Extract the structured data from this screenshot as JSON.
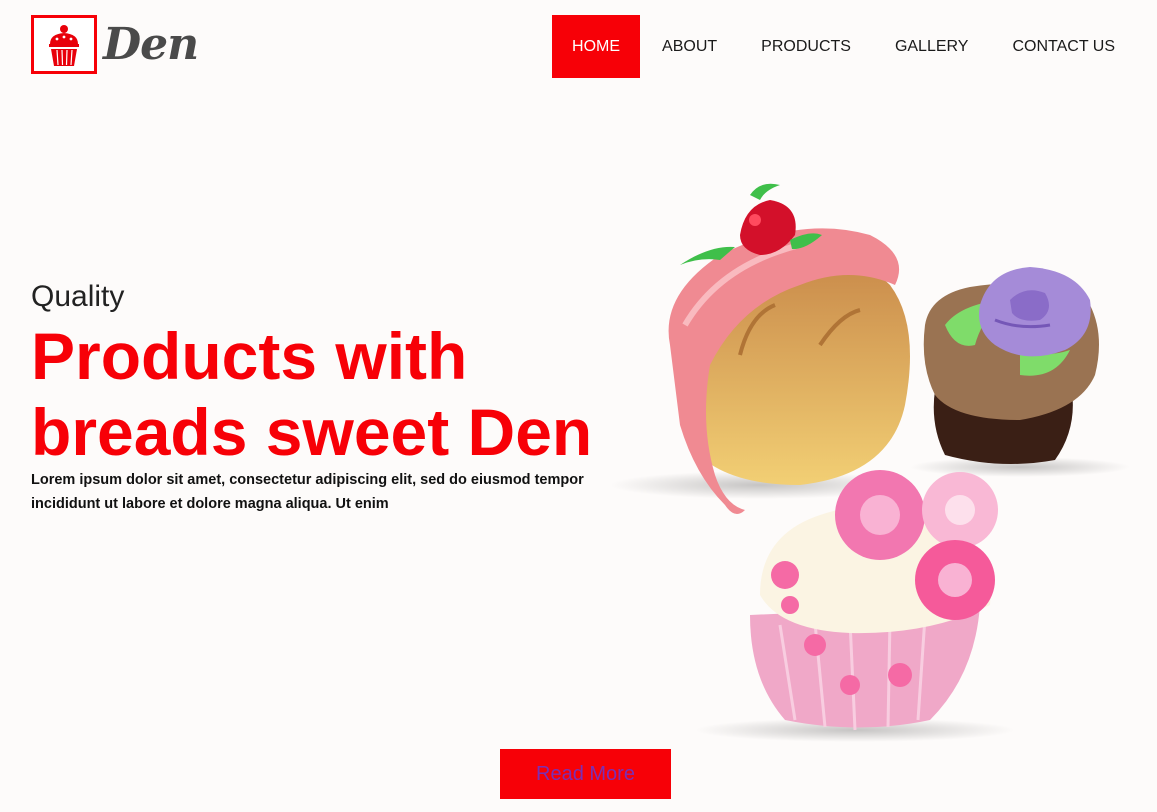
{
  "brand": {
    "name": "Den",
    "logo_icon": "cupcake-icon"
  },
  "nav": {
    "items": [
      {
        "label": "HOME",
        "active": true
      },
      {
        "label": "ABOUT",
        "active": false
      },
      {
        "label": "PRODUCTS",
        "active": false
      },
      {
        "label": "GALLERY",
        "active": false
      },
      {
        "label": "CONTACT US",
        "active": false
      }
    ]
  },
  "hero": {
    "subtitle": "Quality",
    "title": "Products with breads sweet Den",
    "description": "Lorem ipsum dolor sit amet, consectetur adipiscing elit, sed do eiusmod tempor incididunt ut labore et dolore magna aliqua. Ut enim",
    "cta_label": "Read More"
  },
  "colors": {
    "accent": "#f70007",
    "text": "#1a1a1a",
    "background": "#fdfbfa",
    "cta_text": "#7b2fb5"
  }
}
